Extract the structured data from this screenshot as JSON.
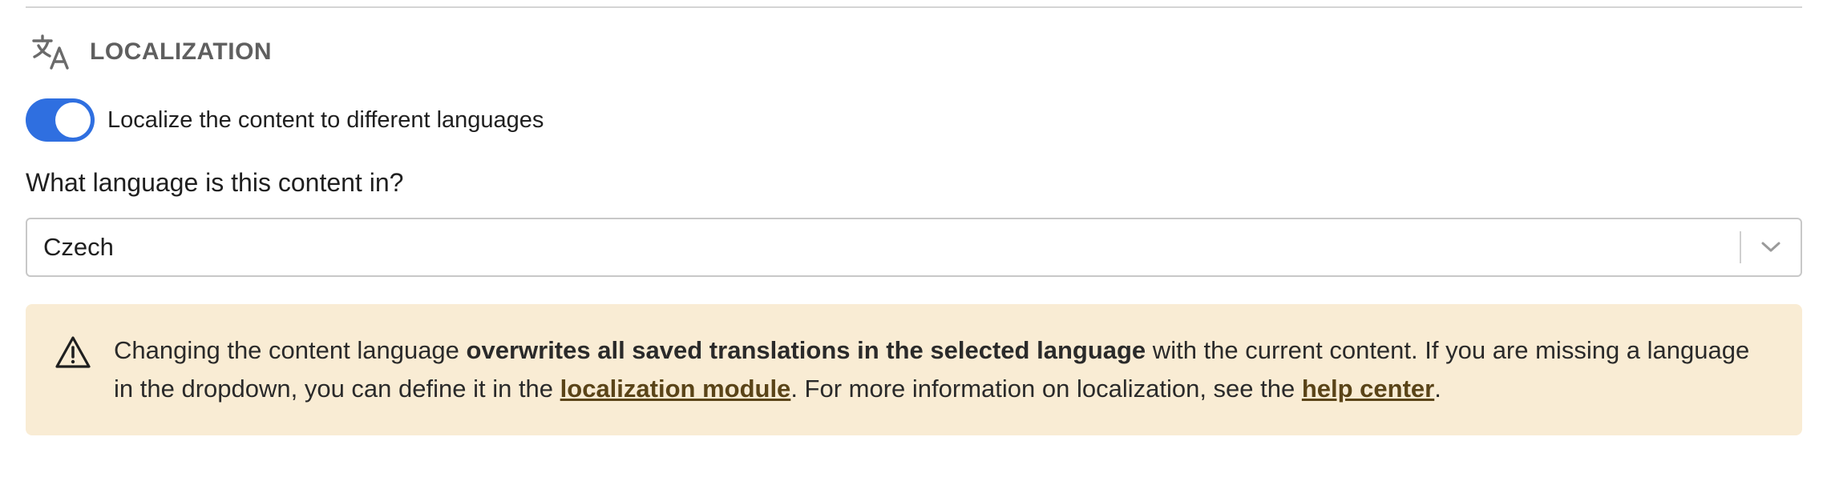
{
  "section": {
    "title": "LOCALIZATION",
    "icon": "translate-icon"
  },
  "toggle": {
    "label": "Localize the content to different languages",
    "state": "on",
    "color": "#2f6fe0"
  },
  "language": {
    "question": "What language is this content in?",
    "selected": "Czech",
    "icon": "chevron-down-icon"
  },
  "callout": {
    "icon": "warning-icon",
    "background": "#f9ecd4",
    "text_1": "Changing the content language ",
    "bold": "overwrites all saved translations in the selected language",
    "text_2": " with the current content. If you are missing a language in the dropdown, you can define it in the ",
    "link_1": "localization module",
    "text_3": ". For more information on localization, see the ",
    "link_2": "help center",
    "text_4": "."
  }
}
